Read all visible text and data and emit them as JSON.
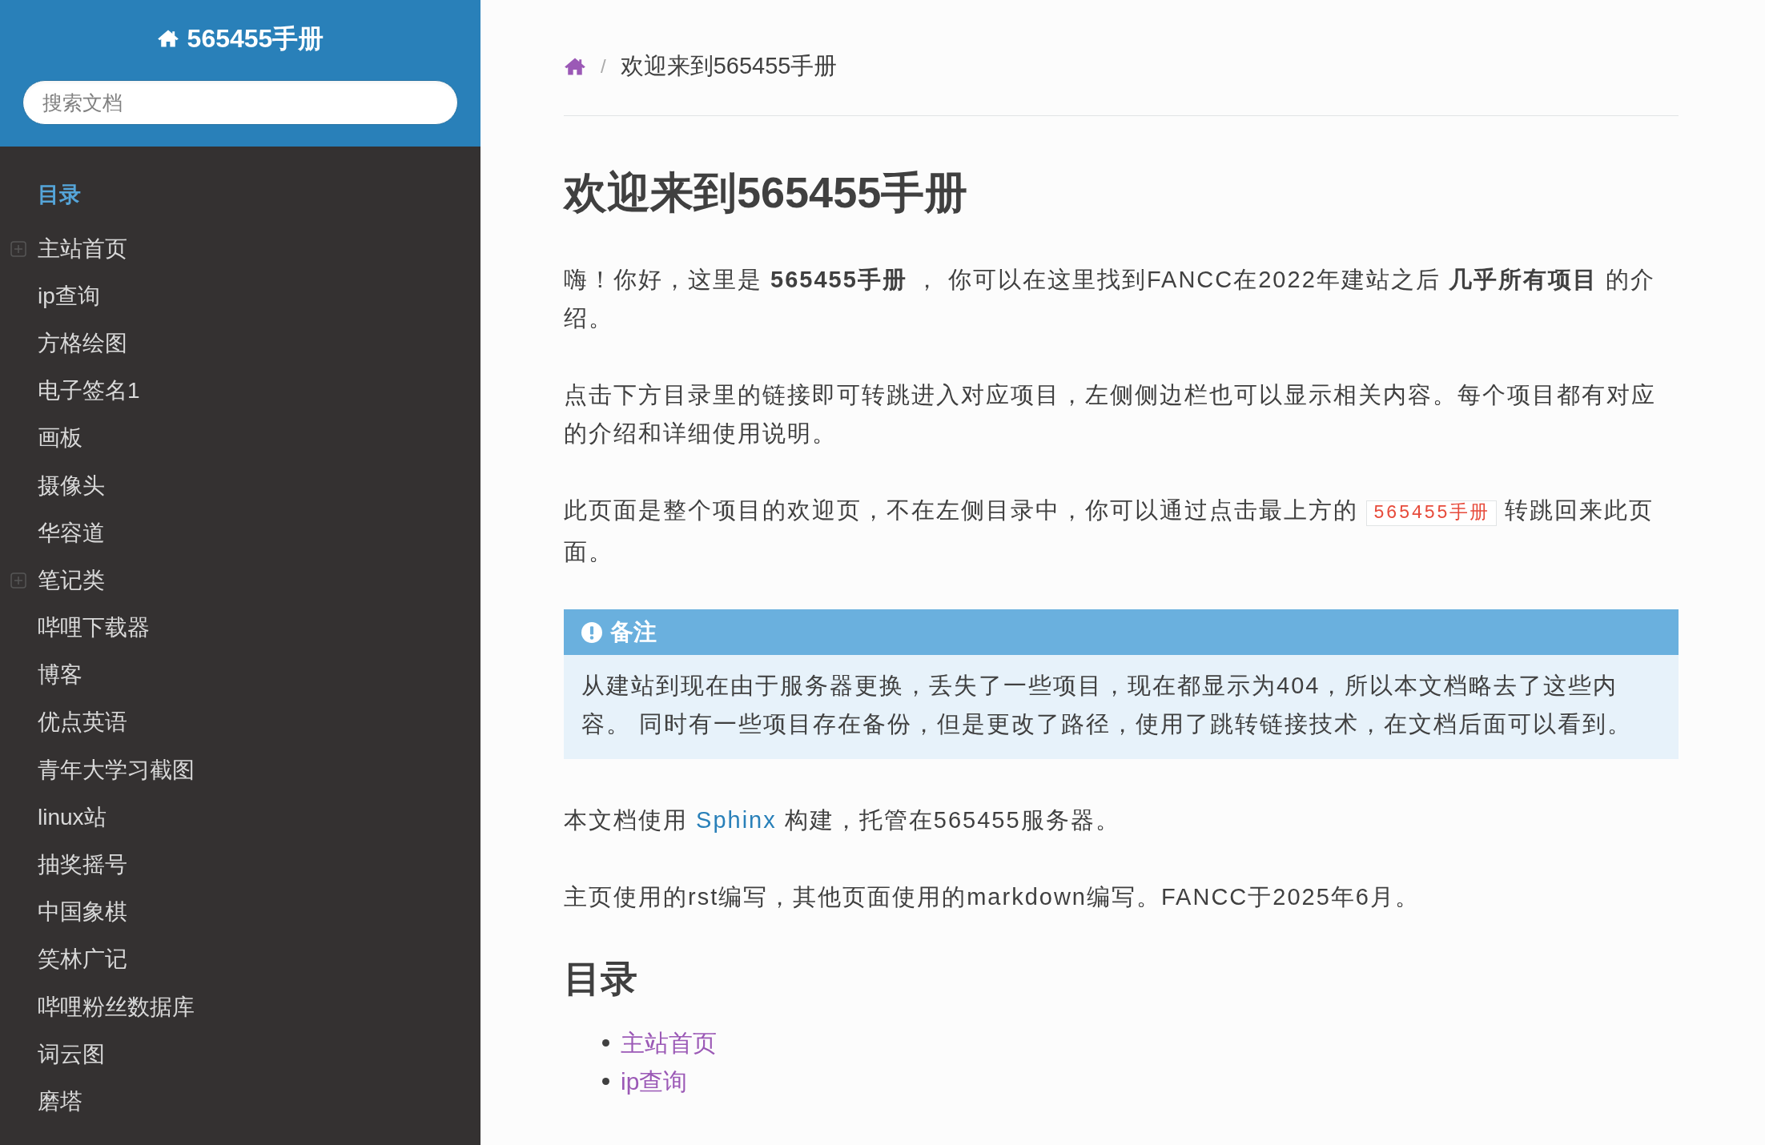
{
  "sidebar": {
    "title": "565455手册",
    "search": {
      "placeholder": "搜索文档"
    },
    "caption": "目录",
    "items": [
      {
        "label": "主站首页",
        "expandable": true
      },
      {
        "label": "ip查询",
        "expandable": false
      },
      {
        "label": "方格绘图",
        "expandable": false
      },
      {
        "label": "电子签名1",
        "expandable": false
      },
      {
        "label": "画板",
        "expandable": false
      },
      {
        "label": "摄像头",
        "expandable": false
      },
      {
        "label": "华容道",
        "expandable": false
      },
      {
        "label": "笔记类",
        "expandable": true
      },
      {
        "label": "哔哩下载器",
        "expandable": false
      },
      {
        "label": "博客",
        "expandable": false
      },
      {
        "label": "优点英语",
        "expandable": false
      },
      {
        "label": "青年大学习截图",
        "expandable": false
      },
      {
        "label": "linux站",
        "expandable": false
      },
      {
        "label": "抽奖摇号",
        "expandable": false
      },
      {
        "label": "中国象棋",
        "expandable": false
      },
      {
        "label": "笑林广记",
        "expandable": false
      },
      {
        "label": "哔哩粉丝数据库",
        "expandable": false
      },
      {
        "label": "词云图",
        "expandable": false
      },
      {
        "label": "磨塔",
        "expandable": false
      }
    ]
  },
  "breadcrumb": {
    "separator": "/",
    "current": "欢迎来到565455手册"
  },
  "content": {
    "title": "欢迎来到565455手册",
    "blocks": [
      {
        "kind": "paragraph",
        "text": "嗨！你好，这里是 **565455手册** ， 你可以在这里找到FANCC在2022年建站之后 **几乎所有项目** 的介绍。"
      },
      {
        "kind": "paragraph",
        "text": "点击下方目录里的链接即可转跳进入对应项目，左侧侧边栏也可以显示相关内容。每个项目都有对应的介绍和详细使用说明。"
      },
      {
        "kind": "code",
        "before": "此页面是整个项目的欢迎页，不在左侧目录中，你可以通过点击最上方的 ",
        "code": "565455手册",
        "after": " 转跳回来此页面。"
      },
      {
        "kind": "note",
        "title": "备注",
        "text": "从建站到现在由于服务器更换，丢失了一些项目，现在都显示为404，所以本文档略去了这些内容。 同时有一些项目存在备份，但是更改了路径，使用了跳转链接技术，在文档后面可以看到。"
      },
      {
        "kind": "link",
        "before": "本文档使用 ",
        "link": "Sphinx",
        "after": " 构建，托管在565455服务器。"
      },
      {
        "kind": "paragraph",
        "text": "主页使用的rst编写，其他页面使用的markdown编写。FANCC于2025年6月。"
      },
      {
        "kind": "heading",
        "text": "目录"
      },
      {
        "kind": "list",
        "items": [
          "主站首页",
          "ip查询"
        ]
      }
    ]
  }
}
